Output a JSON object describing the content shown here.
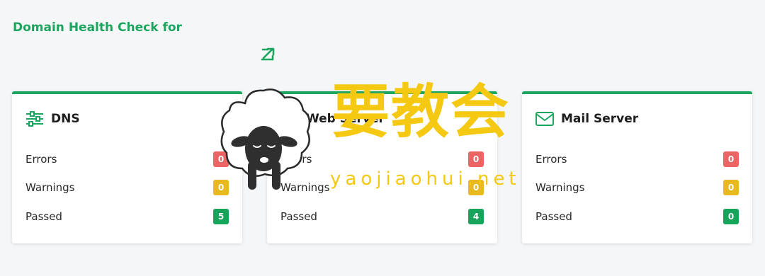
{
  "header": {
    "title": "Domain Health Check for"
  },
  "icons": {
    "external_link": "external-link-icon",
    "dns": "sliders-icon",
    "web": "globe-icon",
    "mail": "envelope-icon"
  },
  "colors": {
    "accent": "#1ba55e",
    "error": "#ec6464",
    "warning": "#e9b91f",
    "passed": "#16a35a"
  },
  "cards": [
    {
      "title": "DNS",
      "rows": [
        {
          "label": "Errors",
          "value": "0"
        },
        {
          "label": "Warnings",
          "value": "0"
        },
        {
          "label": "Passed",
          "value": "5"
        }
      ]
    },
    {
      "title": "Web Server",
      "rows": [
        {
          "label": "Errors",
          "value": "0"
        },
        {
          "label": "Warnings",
          "value": "0"
        },
        {
          "label": "Passed",
          "value": "4"
        }
      ]
    },
    {
      "title": "Mail Server",
      "rows": [
        {
          "label": "Errors",
          "value": "0"
        },
        {
          "label": "Warnings",
          "value": "0"
        },
        {
          "label": "Passed",
          "value": "0"
        }
      ]
    }
  ],
  "watermark": {
    "text": "要教会",
    "url": "yaojiaohui.net"
  }
}
